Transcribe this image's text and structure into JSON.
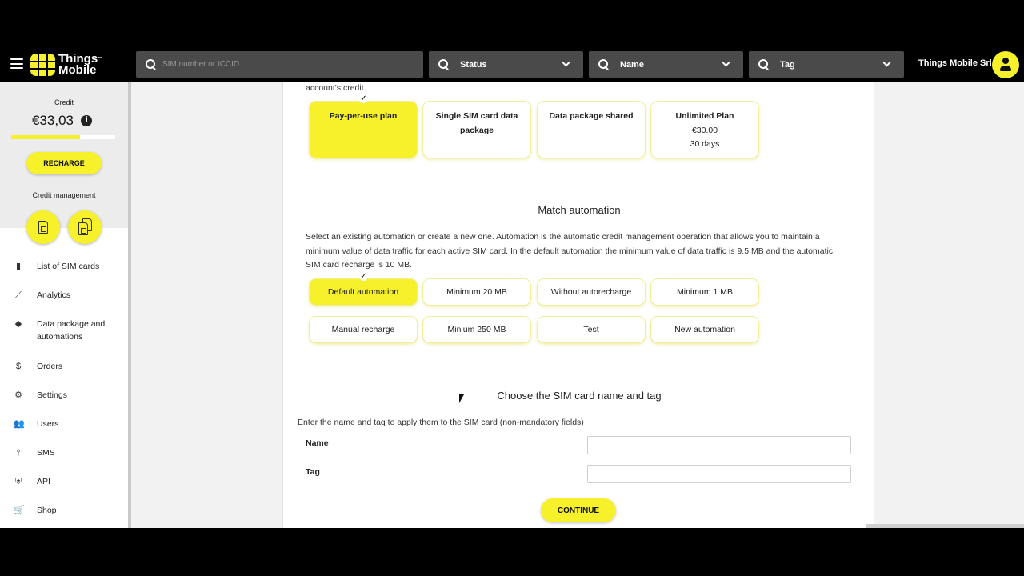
{
  "header": {
    "brand_line1": "Things",
    "brand_line2": "Mobile",
    "brand_tm": "™",
    "search_placeholder": "SIM number or ICCID",
    "status_label": "Status",
    "name_label": "Name",
    "tag_label": "Tag",
    "company": "Things Mobile Srl"
  },
  "sidebar": {
    "credit_label": "Credit",
    "credit_value": "€33,03",
    "credit_fill_fraction": 0.66,
    "info_glyph": "i",
    "recharge_label": "RECHARGE",
    "credit_management_label": "Credit management",
    "items": [
      {
        "label": "List of SIM cards",
        "icon": "sim-card-icon"
      },
      {
        "label": "Analytics",
        "icon": "trend-line-icon"
      },
      {
        "label": "Data package and automations",
        "icon": "layers-icon"
      },
      {
        "label": "Orders",
        "icon": "dollar-icon"
      },
      {
        "label": "Settings",
        "icon": "gear-icon"
      },
      {
        "label": "Users",
        "icon": "users-icon"
      },
      {
        "label": "SMS",
        "icon": "antenna-icon"
      },
      {
        "label": "API",
        "icon": "shield-check-icon"
      },
      {
        "label": "Shop",
        "icon": "cart-icon"
      }
    ]
  },
  "main": {
    "intro_tail": "account's credit.",
    "plans": [
      {
        "line1": "Pay-per-use plan",
        "line2": "",
        "line3": "",
        "selected": true
      },
      {
        "line1": "Single SIM card data",
        "line2": "package",
        "line3": "",
        "selected": false
      },
      {
        "line1": "Data package shared",
        "line2": "",
        "line3": "",
        "selected": false
      },
      {
        "line1": "Unlimited Plan",
        "line2": "€30.00",
        "line3": "30 days",
        "selected": false
      }
    ],
    "automation_title": "Match automation",
    "automation_desc": "Select an existing automation or create a new one. Automation is the automatic credit management operation that allows you to maintain a minimum value of data traffic for each active SIM card. In the default automation the minimum value of data traffic is 9.5 MB and the automatic SIM card recharge is 10 MB.",
    "automations": [
      {
        "label": "Default automation",
        "selected": true
      },
      {
        "label": "Minimum 20 MB",
        "selected": false
      },
      {
        "label": "Without autorecharge",
        "selected": false
      },
      {
        "label": "Minimum 1 MB",
        "selected": false
      },
      {
        "label": "Manual recharge",
        "selected": false
      },
      {
        "label": "Minium 250 MB",
        "selected": false
      },
      {
        "label": "Test",
        "selected": false
      },
      {
        "label": "New automation",
        "selected": false
      }
    ],
    "check_glyph": "✓",
    "name_tag_title": "Choose the SIM card name and tag",
    "name_tag_desc": "Enter the name and tag to apply them to the SIM card (non-mandatory fields)",
    "name_field_label": "Name",
    "name_field_value": "",
    "tag_field_label": "Tag",
    "tag_field_value": "",
    "continue_label": "CONTINUE"
  },
  "colors": {
    "accent": "#f6f12b",
    "topbar": "#000000",
    "search_bg": "#4a4a4a"
  }
}
